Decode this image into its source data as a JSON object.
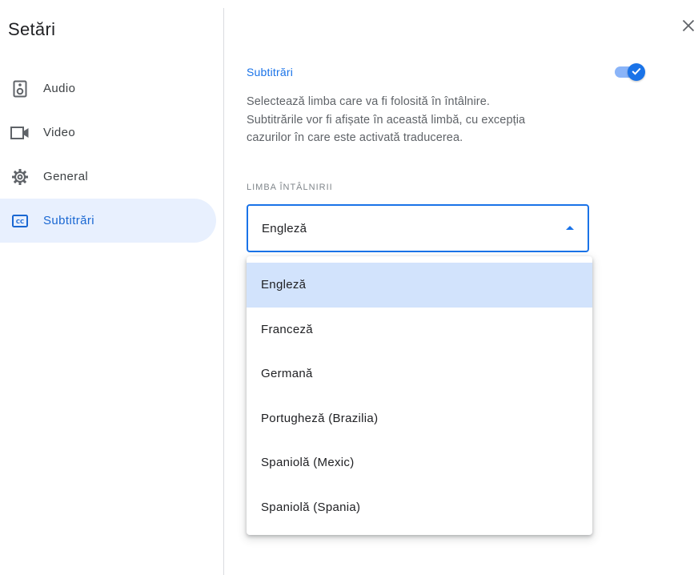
{
  "dialog": {
    "title": "Setări"
  },
  "sidebar": {
    "items": [
      {
        "label": "Audio",
        "icon": "speaker-icon",
        "active": false
      },
      {
        "label": "Video",
        "icon": "videocam-icon",
        "active": false
      },
      {
        "label": "General",
        "icon": "gear-icon",
        "active": false
      },
      {
        "label": "Subtitrări",
        "icon": "closed-caption-icon",
        "active": true
      }
    ]
  },
  "captions": {
    "title": "Subtitrări",
    "enabled": true,
    "description": "Selectează limba care va fi folosită în întâlnire. Subtitrările vor fi afișate în această limbă, cu excepția cazurilor în care este activată traducerea.",
    "field_label": "LIMBA ÎNTÂLNIRII",
    "selected_language": "Engleză",
    "options": [
      {
        "label": "Engleză",
        "selected": true
      },
      {
        "label": "Franceză",
        "selected": false
      },
      {
        "label": "Germană",
        "selected": false
      },
      {
        "label": "Portugheză (Brazilia)",
        "selected": false
      },
      {
        "label": "Spaniolă (Mexic)",
        "selected": false
      },
      {
        "label": "Spaniolă (Spania)",
        "selected": false
      }
    ]
  },
  "colors": {
    "accent": "#1a73e8",
    "active_nav_bg": "#e8f0fe",
    "selected_option_bg": "#d2e3fc",
    "toggle_track": "#8ab4f8"
  }
}
